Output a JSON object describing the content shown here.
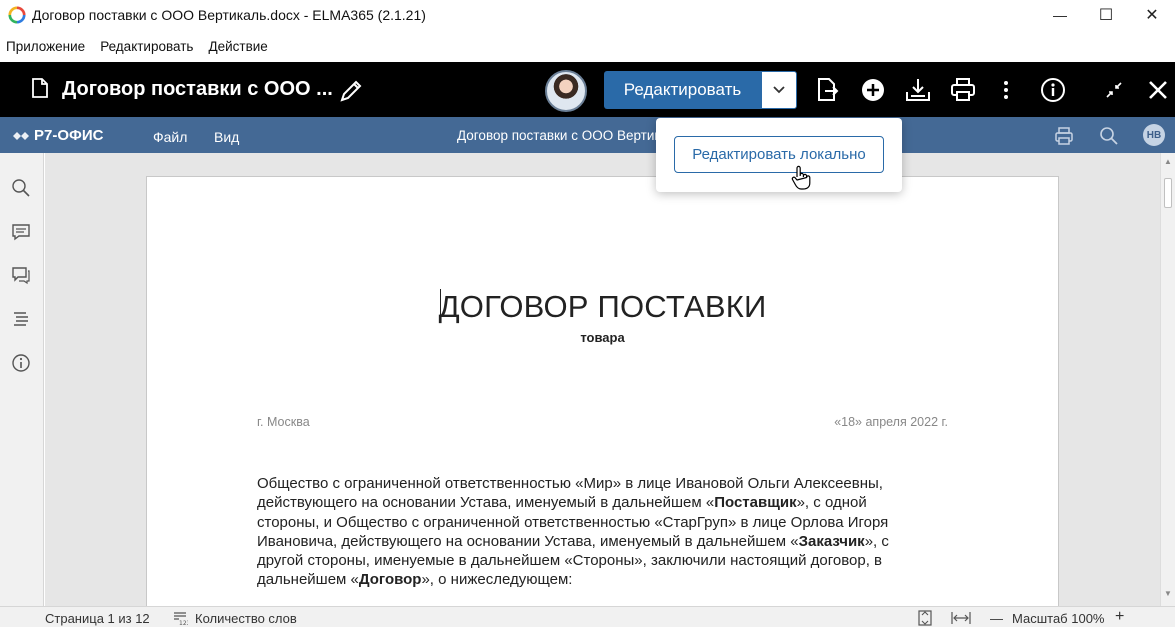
{
  "window": {
    "title": "Договор поставки с ООО Вертикаль.docx - ELMA365 (2.1.21)",
    "controls": {
      "minimize": "—",
      "maximize": "☐",
      "close": "✕"
    }
  },
  "menu": [
    "Приложение",
    "Редактировать",
    "Действие"
  ],
  "toolbar": {
    "doc_title": "Договор поставки с ООО ...",
    "edit_label": "Редактировать",
    "icons": [
      "document-icon",
      "pencil-icon",
      "avatar",
      "chevron-down-icon",
      "file-export-icon",
      "add-circle-icon",
      "download-icon",
      "print-icon",
      "more-vert-icon",
      "info-icon",
      "collapse-icon",
      "close-icon"
    ]
  },
  "popup": {
    "edit_locally_label": "Редактировать локально"
  },
  "editor_header": {
    "logo_text": "Р7-ОФИС",
    "menu_file": "Файл",
    "menu_view": "Вид",
    "doc_title": "Договор поставки с ООО Вертикаль",
    "user_initials": "НВ"
  },
  "document": {
    "heading": "ДОГОВОР ПОСТАВКИ",
    "subheading": "товара",
    "city": "г. Москва",
    "date": "«18» апреля 2022 г.",
    "paragraph": [
      {
        "t": "Общество с ограниченной ответственностью «Мир» в лице Ивановой Ольги Алексеевны, действующего на основании Устава, именуемый в дальнейшем «",
        "b": false
      },
      {
        "t": "Поставщик",
        "b": true
      },
      {
        "t": "», с одной стороны, и Общество с ограниченной ответственностью «СтарГруп» в лице Орлова Игоря Ивановича, действующего на основании Устава, именуемый в дальнейшем «",
        "b": false
      },
      {
        "t": "Заказчик",
        "b": true
      },
      {
        "t": "», с другой стороны, именуемые в дальнейшем «Стороны», заключили настоящий договор, в дальнейшем «",
        "b": false
      },
      {
        "t": "Договор",
        "b": true
      },
      {
        "t": "», о нижеследующем:",
        "b": false
      }
    ]
  },
  "statusbar": {
    "page_info": "Страница 1 из 12",
    "word_count": "Количество слов",
    "zoom_label": "Масштаб 100%",
    "zoom_minus": "—",
    "zoom_plus": "+"
  },
  "colors": {
    "accent": "#2a6aa8",
    "editor_header": "#446995",
    "toolbar": "#000000"
  }
}
